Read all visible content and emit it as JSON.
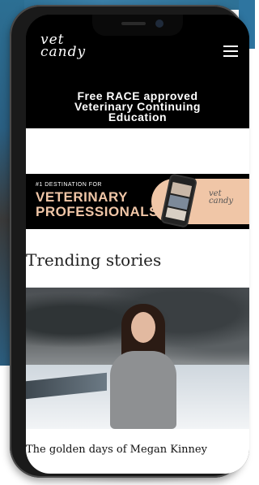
{
  "header": {
    "logo_line1": "vet",
    "logo_line2": "candy",
    "menu_icon": "hamburger-menu-icon"
  },
  "banner": {
    "line1": "Free RACE approved",
    "line2": "Veterinary Continuing",
    "line3": "Education"
  },
  "ad": {
    "kicker": "#1 DESTINATION FOR",
    "title_line1": "VETERINARY",
    "title_line2": "PROFESSIONALS",
    "logo_line1": "vet",
    "logo_line2": "candy",
    "accent": "#f0c6a7"
  },
  "section": {
    "title": "Trending stories"
  },
  "story": {
    "title": "The golden days of Megan Kinney"
  }
}
